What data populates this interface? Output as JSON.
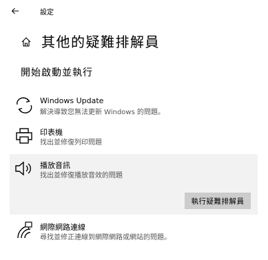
{
  "window": {
    "title": "設定"
  },
  "page": {
    "title": "其他的疑難排解員"
  },
  "section": {
    "title": "開始啟動並執行"
  },
  "items": [
    {
      "name": "Windows Update",
      "description": "解決導致您無法更新 Windows 的問題。",
      "icon": "windows-update-icon"
    },
    {
      "name": "印表機",
      "description": "找出並修復列印問題",
      "icon": "printer-icon"
    },
    {
      "name": "播放音訊",
      "description": "找出並修復播放音效的問題",
      "icon": "speaker-icon",
      "button_label": "執行疑難排解員"
    },
    {
      "name": "網際網路連線",
      "description": "尋找並修正連線到網際網路或網站的問題。",
      "icon": "internet-connection-icon"
    }
  ],
  "colors": {
    "expanded_background": "#f2f2f2",
    "button_background": "#cccccc",
    "secondary_text": "#555555"
  }
}
